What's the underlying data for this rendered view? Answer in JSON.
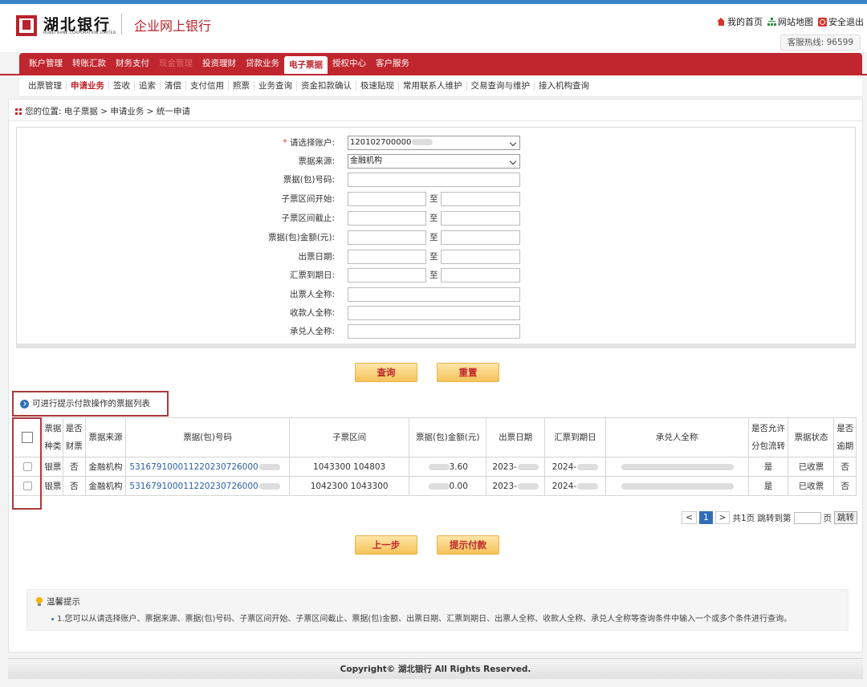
{
  "header": {
    "logo_cn": "湖北银行",
    "logo_en": "HUBEI BANK CORPORATION LIMITED",
    "subtitle": "企业网上银行",
    "home_link": "我的首页",
    "sitemap_link": "网站地图",
    "logout_link": "安全退出",
    "hotline": "客服热线: 96599"
  },
  "main_nav": [
    {
      "label": "账户管理"
    },
    {
      "label": "转账汇款"
    },
    {
      "label": "财务支付"
    },
    {
      "label": "现金管理"
    },
    {
      "label": "投资理财"
    },
    {
      "label": "贷款业务"
    },
    {
      "label": "电子票据"
    },
    {
      "label": "授权中心"
    },
    {
      "label": "客户服务"
    }
  ],
  "sub_nav": [
    {
      "label": "出票管理"
    },
    {
      "label": "申请业务"
    },
    {
      "label": "签收"
    },
    {
      "label": "追索"
    },
    {
      "label": "清偿"
    },
    {
      "label": "支付信用"
    },
    {
      "label": "照票"
    },
    {
      "label": "业务查询"
    },
    {
      "label": "资金扣款确认"
    },
    {
      "label": "极速贴现"
    },
    {
      "label": "常用联系人维护"
    },
    {
      "label": "交易查询与维护"
    },
    {
      "label": "接入机构查询"
    }
  ],
  "breadcrumb": "您的位置: 电子票据 > 申请业务 > 统一申请",
  "form": {
    "account_label": "请选择账户:",
    "account_required": "*",
    "account_value": "120102700000",
    "source_label": "票据来源:",
    "source_value": "金融机构",
    "bill_no_label": "票据(包)号码:",
    "sub_start_label": "子票区间开始:",
    "sub_end_label": "子票区间截止:",
    "amount_label": "票据(包)金额(元):",
    "issue_date_label": "出票日期:",
    "due_date_label": "汇票到期日:",
    "drawer_label": "出票人全称:",
    "payee_label": "收款人全称:",
    "acceptor_label": "承兑人全称:",
    "to": "至"
  },
  "buttons": {
    "query": "查询",
    "reset": "重置",
    "prev": "上一步",
    "submit": "提示付款"
  },
  "list_title": "可进行提示付款操作的票据列表",
  "table": {
    "headers": [
      "票据种类",
      "是否财票",
      "票据来源",
      "票据(包)号码",
      "子票区间",
      "票据(包)金额(元)",
      "出票日期",
      "汇票到期日",
      "承兑人全称",
      "是否允许分包流转",
      "票据状态",
      "是否逾期"
    ],
    "rows": [
      {
        "kind": "银票",
        "fin": "否",
        "source": "金融机构",
        "bill_no": "531679100011220230726000",
        "range": "1043300 104803",
        "amount": "3.60",
        "issue": "2023-",
        "due": "2024-",
        "acceptor": "",
        "split": "是",
        "status": "已收票",
        "overdue": "否"
      },
      {
        "kind": "银票",
        "fin": "否",
        "source": "金融机构",
        "bill_no": "531679100011220230726000",
        "range": "1042300 1043300",
        "amount": "0.00",
        "issue": "2023-",
        "due": "2024-",
        "acceptor": "",
        "split": "是",
        "status": "已收票",
        "overdue": "否"
      }
    ]
  },
  "pager": {
    "prev": "<",
    "current": "1",
    "next": ">",
    "total_text": "共1页 跳转到第",
    "page_suffix": "页",
    "go": "跳转"
  },
  "tips": {
    "title": "温馨提示",
    "line1": "1.您可以从请选择账户、票据来源、票据(包)号码、子票区间开始、子票区间截止、票据(包)金额、出票日期、汇票到期日、出票人全称、收款人全称、承兑人全称等查询条件中输入一个或多个条件进行查询。"
  },
  "footer": "Copyright© 湖北银行 All Rights Reserved.",
  "colors": {
    "brand_red": "#c0262e",
    "link_blue": "#2a5ea8",
    "button_gold": "#f6c35a"
  }
}
